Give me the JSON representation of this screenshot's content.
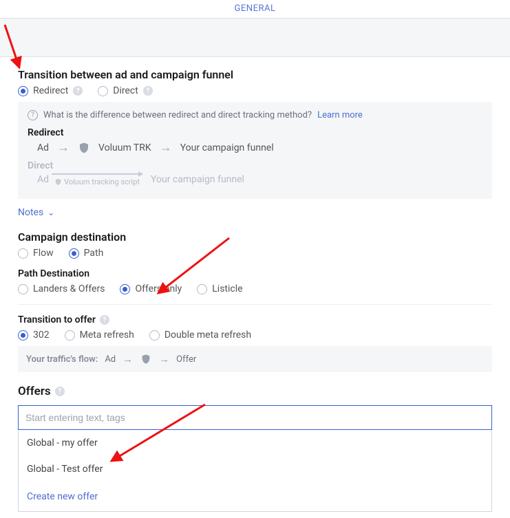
{
  "tab": "GENERAL",
  "transition": {
    "title": "Transition between ad and campaign funnel",
    "options": {
      "redirect": "Redirect",
      "direct": "Direct"
    },
    "info": {
      "question": "What is the difference between redirect and direct tracking method?",
      "learn_more": "Learn more"
    },
    "redirect_block": {
      "title": "Redirect",
      "ad": "Ad",
      "trk": "Voluum TRK",
      "dest": "Your campaign funnel"
    },
    "direct_block": {
      "title": "Direct",
      "ad": "Ad",
      "script": "Voluum tracking script",
      "dest": "Your campaign funnel"
    },
    "notes": "Notes"
  },
  "destination": {
    "title": "Campaign destination",
    "options": {
      "flow": "Flow",
      "path": "Path"
    },
    "path_dest_label": "Path Destination",
    "path_options": {
      "landers_offers": "Landers & Offers",
      "offers_only": "Offers only",
      "listicle": "Listicle"
    }
  },
  "transition_offer": {
    "title": "Transition to offer",
    "options": {
      "r302": "302",
      "meta": "Meta refresh",
      "double_meta": "Double meta refresh"
    },
    "flow_label": "Your traffic's flow:",
    "ad": "Ad",
    "offer": "Offer"
  },
  "offers": {
    "title": "Offers",
    "placeholder": "Start entering text, tags",
    "items": [
      "Global - my offer",
      "Global - Test offer"
    ],
    "create": "Create new offer"
  }
}
